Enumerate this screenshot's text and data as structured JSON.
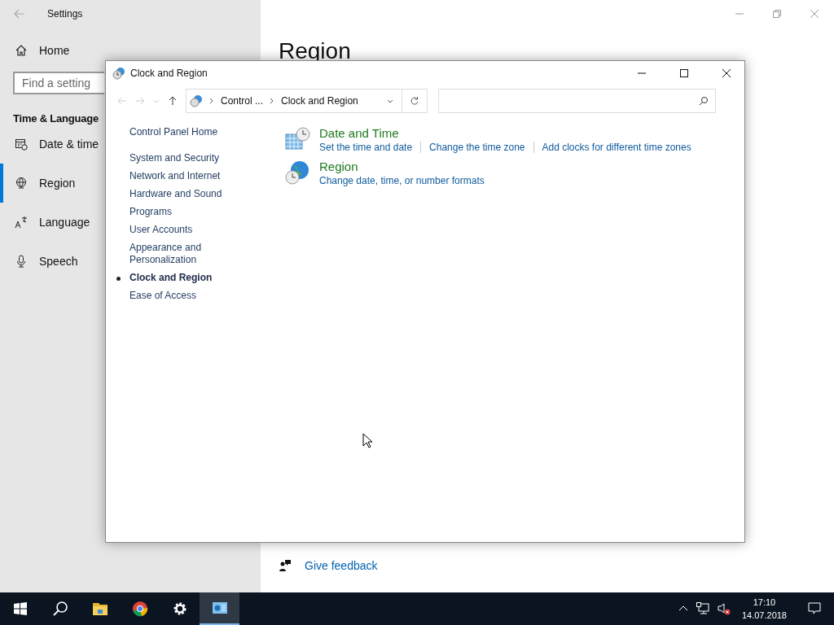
{
  "settings": {
    "title": "Settings",
    "home": "Home",
    "search": {
      "placeholder": "Find a setting"
    },
    "section": "Time & Language",
    "nav": [
      {
        "label": "Date & time",
        "selected": false
      },
      {
        "label": "Region",
        "selected": true
      },
      {
        "label": "Language",
        "selected": false
      },
      {
        "label": "Speech",
        "selected": false
      }
    ],
    "heading": "Region",
    "feedback": "Give feedback"
  },
  "control_panel": {
    "title": "Clock and Region",
    "breadcrumb": [
      "Control ...",
      "Clock and Region"
    ],
    "home": "Control Panel Home",
    "items": [
      {
        "label": "System and Security",
        "selected": false
      },
      {
        "label": "Network and Internet",
        "selected": false
      },
      {
        "label": "Hardware and Sound",
        "selected": false
      },
      {
        "label": "Programs",
        "selected": false
      },
      {
        "label": "User Accounts",
        "selected": false
      },
      {
        "label": "Appearance and Personalization",
        "selected": false
      },
      {
        "label": "Clock and Region",
        "selected": true
      },
      {
        "label": "Ease of Access",
        "selected": false
      }
    ],
    "categories": [
      {
        "title": "Date and Time",
        "links": [
          "Set the time and date",
          "Change the time zone",
          "Add clocks for different time zones"
        ]
      },
      {
        "title": "Region",
        "links": [
          "Change date, time, or number formats"
        ]
      }
    ]
  },
  "taskbar": {
    "apps": [
      {
        "kind": "start",
        "selected": false
      },
      {
        "kind": "search",
        "selected": false
      },
      {
        "kind": "folder",
        "selected": false
      },
      {
        "kind": "browser",
        "selected": false
      },
      {
        "kind": "settings",
        "selected": false
      },
      {
        "kind": "control-panel",
        "selected": true
      }
    ],
    "time": "17:10",
    "date": "14.07.2018"
  }
}
